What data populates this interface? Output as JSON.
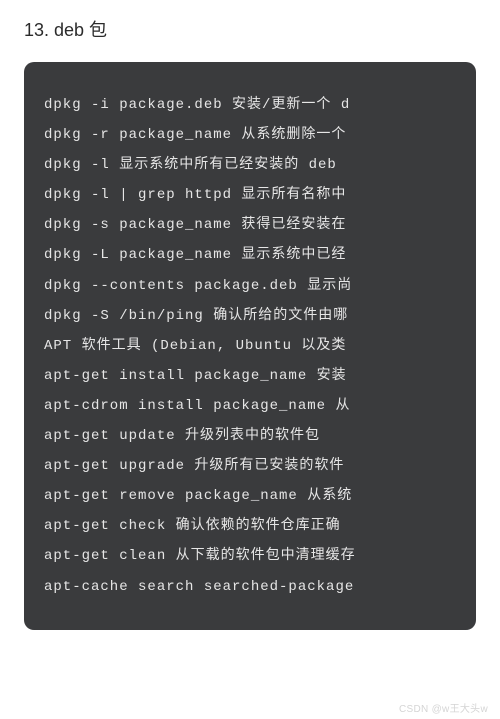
{
  "heading": "13. deb 包",
  "code_lines": [
    "dpkg -i package.deb 安装/更新一个 d",
    "dpkg -r package_name 从系统删除一个",
    "dpkg -l 显示系统中所有已经安装的 deb ",
    "dpkg -l | grep httpd 显示所有名称中",
    "dpkg -s package_name 获得已经安装在",
    "dpkg -L package_name 显示系统中已经",
    "dpkg --contents package.deb 显示尚",
    "dpkg -S /bin/ping 确认所给的文件由哪",
    "APT 软件工具 (Debian, Ubuntu 以及类",
    "apt-get install package_name 安装",
    "apt-cdrom install package_name 从",
    "apt-get update 升级列表中的软件包",
    "apt-get upgrade 升级所有已安装的软件",
    "apt-get remove package_name 从系统",
    "apt-get check 确认依赖的软件仓库正确",
    "apt-get clean 从下载的软件包中清理缓存",
    "apt-cache search searched-package"
  ],
  "watermark": "CSDN @w王大头w"
}
